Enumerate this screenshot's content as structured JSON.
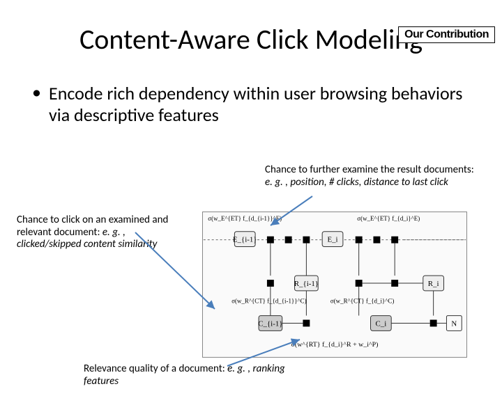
{
  "badge": "Our Contribution",
  "title": "Content-Aware Click Modeling",
  "bullet": "Encode rich dependency within user browsing behaviors via descriptive features",
  "annotations": {
    "right": {
      "lead": "Chance to further examine the result documents: ",
      "eg": "e. g. , position, # clicks, distance to last click"
    },
    "left": {
      "lead": "Chance to click on an examined and relevant document: ",
      "eg": "e. g. , clicked/skipped content similarity"
    },
    "bottom": {
      "lead": "Relevance quality of a document: ",
      "eg": "e. g. , ranking features"
    }
  },
  "diagram": {
    "e_top": {
      "left": "σ(w_E^{ET} f_{d_{i-1}}^E)",
      "right": "σ(w_E^{ET} f_{d_i}^E)"
    },
    "r_mid": {
      "left": "σ(w_R^{CT} f_{d_{i-1}}^C)",
      "right": "σ(w_R^{CT} f_{d_i}^C)"
    },
    "c_bot": "σ(w^{RT} f_{d_i}^R + w_i^P)",
    "nodes": {
      "E_im1": "E_{i-1}",
      "E_i": "E_i",
      "R_im1": "R_{i-1}",
      "R_i": "R_i",
      "C_im1": "C_{i-1}",
      "C_i": "C_i",
      "N": "N"
    }
  }
}
